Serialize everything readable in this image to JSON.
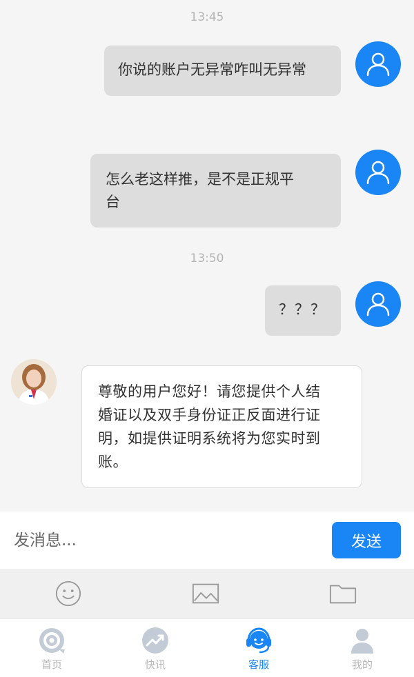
{
  "chat": {
    "timestamps": [
      "13:45",
      "13:50"
    ],
    "user_messages": [
      {
        "text": "你说的账户无异常咋叫无异常"
      },
      {
        "line1": "怎么老这样推，是不是正规平",
        "line2": "台"
      },
      {
        "text": "？？？"
      }
    ],
    "agent_message": {
      "line1": "尊敬的用户您好！请您提供个人结",
      "line2": "婚证以及双手身份证正反面进行证",
      "line3": "明，如提供证明系统将为您实时到",
      "line4": "账。"
    }
  },
  "composer": {
    "placeholder": "发消息...",
    "send_label": "发送"
  },
  "tools": {
    "icons": [
      "smiley-icon",
      "image-icon",
      "folder-icon"
    ]
  },
  "tabbar": {
    "tabs": [
      {
        "label": "首页",
        "icon": "home-target-icon",
        "active": false
      },
      {
        "label": "快讯",
        "icon": "trend-icon",
        "active": false
      },
      {
        "label": "客服",
        "icon": "headset-icon",
        "active": true
      },
      {
        "label": "我的",
        "icon": "person-icon",
        "active": false
      }
    ]
  },
  "colors": {
    "accent": "#1a86f5",
    "background": "#f5f5f5",
    "bubble_out": "#dddddd",
    "inactive": "#b5b5b5"
  }
}
